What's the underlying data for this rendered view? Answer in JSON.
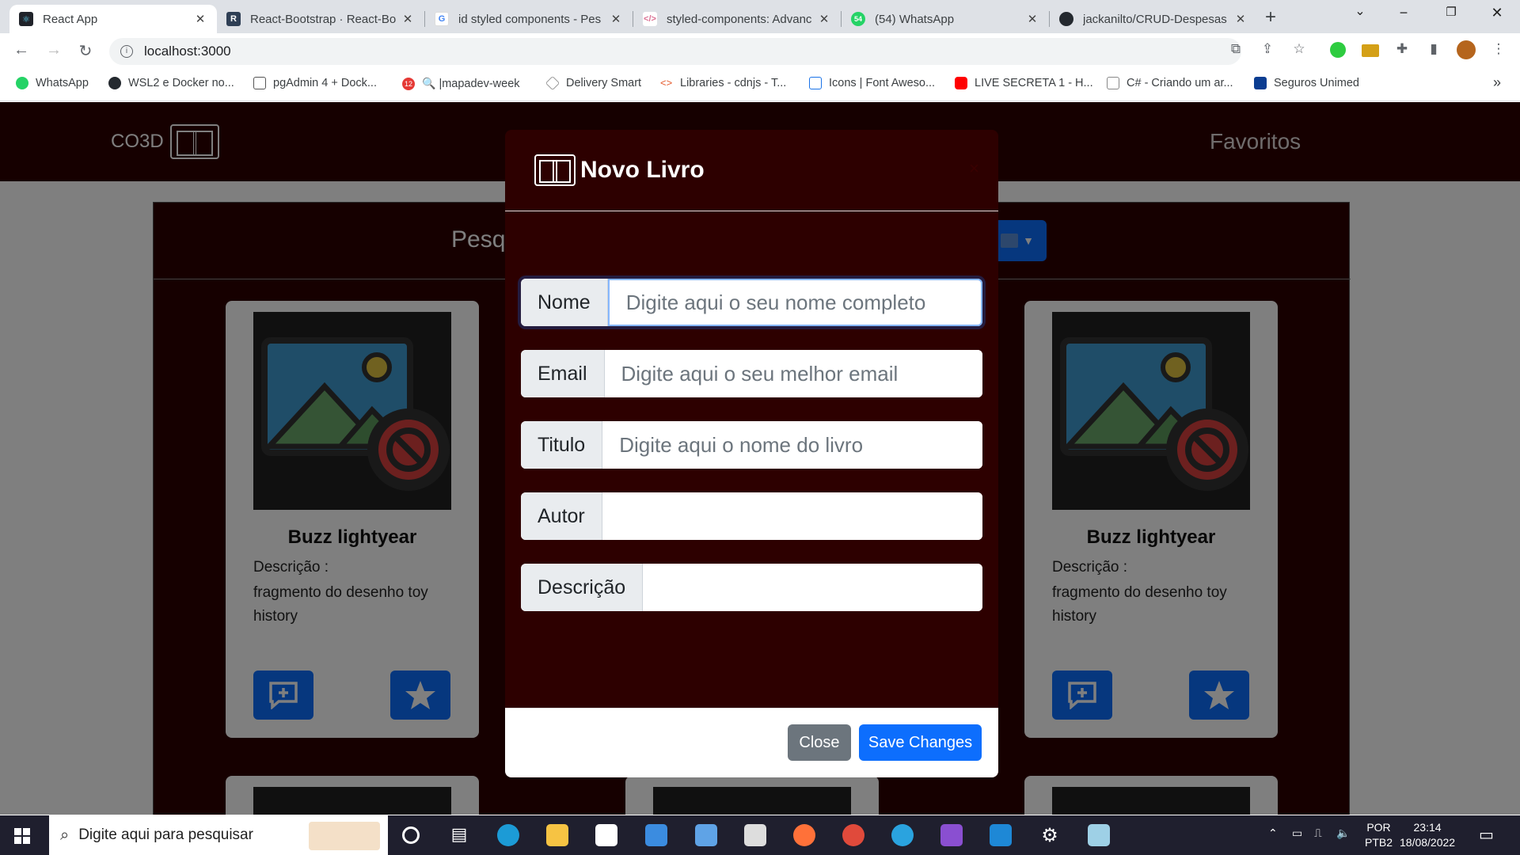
{
  "browser": {
    "tabs": [
      {
        "title": "React App",
        "active": true
      },
      {
        "title": "React-Bootstrap · React-Bo",
        "active": false
      },
      {
        "title": "id styled components - Pes",
        "active": false
      },
      {
        "title": "styled-components: Advanc",
        "active": false
      },
      {
        "title": "(54) WhatsApp",
        "active": false
      },
      {
        "title": "jackanilto/CRUD-Despesas",
        "active": false
      }
    ],
    "url": "localhost:3000",
    "bookmarks": [
      "WhatsApp",
      "WSL2 e Docker no...",
      "pgAdmin 4 + Dock...",
      "|mapadev-week",
      "Delivery Smart",
      "Libraries - cdnjs - T...",
      "Icons | Font Aweso...",
      "LIVE SECRETA 1 - H...",
      "C# - Criando um ar...",
      "Seguros Unimed"
    ],
    "bookmarks_more": "»",
    "whatsapp_badge": "54",
    "pgadmin_badge": "12"
  },
  "app": {
    "brand": "CO3D",
    "nav_link": "Favoritos",
    "search_label": "Pesqu",
    "cards": [
      {
        "name": "Buzz lightyear",
        "desc_label": "Descrição :",
        "desc": "fragmento do desenho toy history"
      },
      {
        "name": "Buzz lightyear",
        "desc_label": "Descrição :",
        "desc": "fragmento do desenho toy history"
      }
    ]
  },
  "modal": {
    "title": "Novo Livro",
    "close_symbol": "×",
    "fields": [
      {
        "label": "Nome",
        "placeholder": "Digite aqui o seu nome completo",
        "value": ""
      },
      {
        "label": "Email",
        "placeholder": "Digite aqui o seu melhor email",
        "value": ""
      },
      {
        "label": "Titulo",
        "placeholder": "Digite aqui o nome do livro",
        "value": ""
      },
      {
        "label": "Autor",
        "placeholder": "",
        "value": ""
      },
      {
        "label": "Descrição",
        "placeholder": "",
        "value": ""
      }
    ],
    "close_label": "Close",
    "save_label": "Save Changes"
  },
  "taskbar": {
    "search_placeholder": "Digite aqui para pesquisar",
    "lang": "POR",
    "layout": "PTB2",
    "time": "23:14",
    "date": "18/08/2022"
  },
  "colors": {
    "brand_bg": "#2d0000",
    "primary": "#0d6efd",
    "secondary": "#6c757d"
  }
}
